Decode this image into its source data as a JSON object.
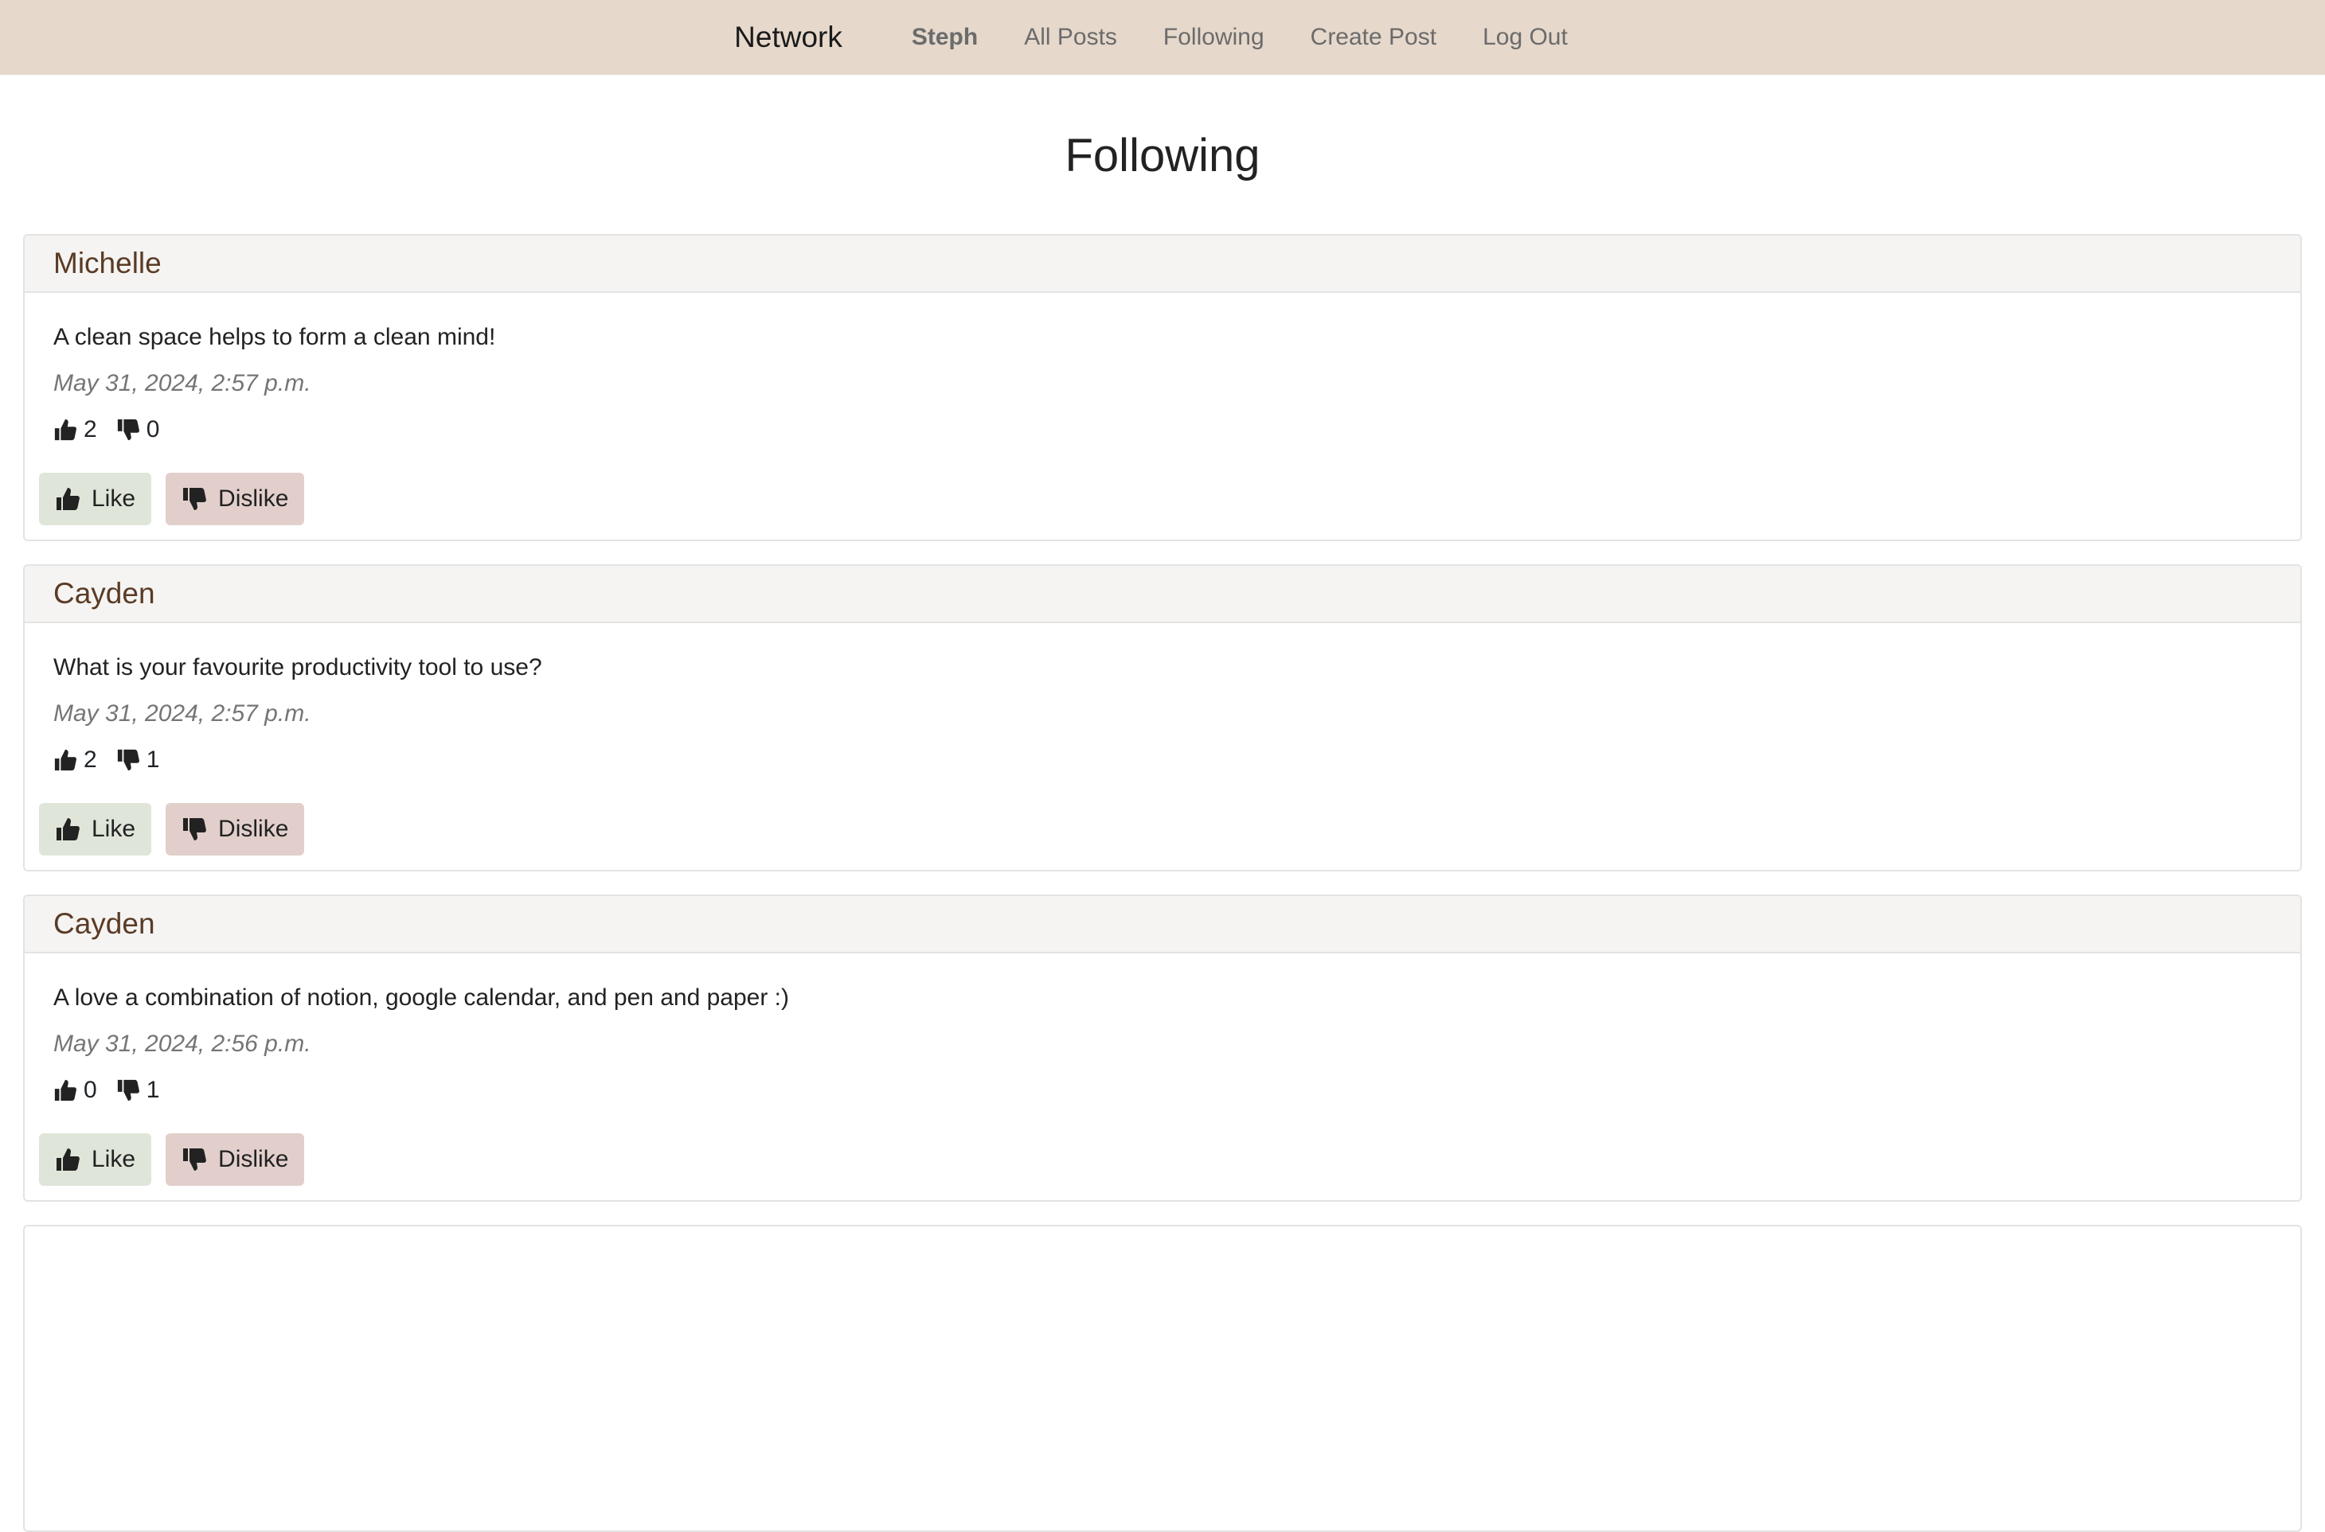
{
  "nav": {
    "brand": "Network",
    "user": "Steph",
    "all_posts": "All Posts",
    "following": "Following",
    "create_post": "Create Post",
    "log_out": "Log Out"
  },
  "page_title": "Following",
  "buttons": {
    "like": "Like",
    "dislike": "Dislike"
  },
  "posts": [
    {
      "author": "Michelle",
      "content": "A clean space helps to form a clean mind!",
      "timestamp": "May 31, 2024, 2:57 p.m.",
      "likes": "2",
      "dislikes": "0"
    },
    {
      "author": "Cayden",
      "content": "What is your favourite productivity tool to use?",
      "timestamp": "May 31, 2024, 2:57 p.m.",
      "likes": "2",
      "dislikes": "1"
    },
    {
      "author": "Cayden",
      "content": "A love a combination of notion, google calendar, and pen and paper :)",
      "timestamp": "May 31, 2024, 2:56 p.m.",
      "likes": "0",
      "dislikes": "1"
    }
  ],
  "colors": {
    "navbar": "#e6d8cb",
    "author": "#5a3b26",
    "like_button": "#dfe6d9",
    "dislike_button": "#e2cfcb"
  }
}
